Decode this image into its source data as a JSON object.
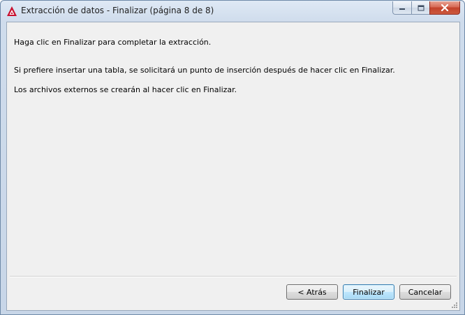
{
  "window": {
    "title": "Extracción de datos - Finalizar (página 8 de 8)"
  },
  "content": {
    "line1": "Haga clic en Finalizar para completar la extracción.",
    "line2": "Si prefiere insertar una tabla, se solicitará un punto de inserción después de hacer clic en Finalizar.",
    "line3": "Los archivos externos se crearán al hacer clic en Finalizar."
  },
  "buttons": {
    "back": "< Atrás",
    "finish": "Finalizar",
    "cancel": "Cancelar"
  },
  "icons": {
    "app": "autocad-logo-icon",
    "minimize": "minimize-icon",
    "maximize": "maximize-icon",
    "close": "close-icon",
    "grip": "resize-grip-icon"
  },
  "colors": {
    "app_icon": "#c8102e",
    "close_button": "#c2422b",
    "default_button_border": "#3c7fb1"
  }
}
